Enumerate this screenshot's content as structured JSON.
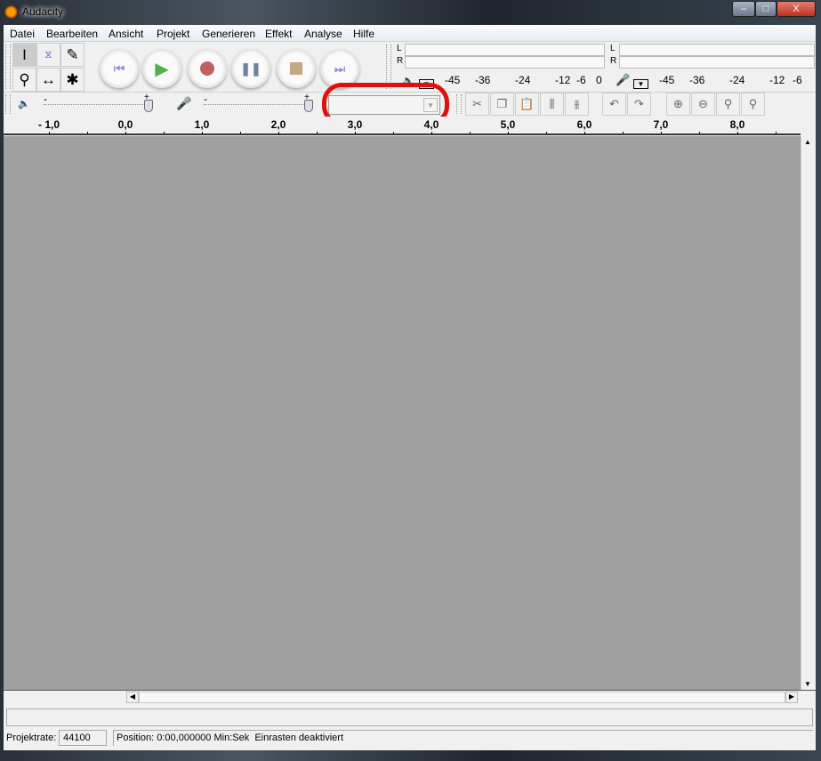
{
  "window": {
    "title": "Audacity",
    "minimize": "–",
    "maximize": "□",
    "close": "X"
  },
  "menu": [
    "Datei",
    "Bearbeiten",
    "Ansicht",
    "Projekt",
    "Generieren",
    "Effekt",
    "Analyse",
    "Hilfe"
  ],
  "tools": {
    "selection": "I",
    "envelope": "envelope",
    "draw": "✎",
    "zoom": "⚲",
    "timeshift": "↔",
    "multi": "✱"
  },
  "transport": [
    "skip-start",
    "play",
    "record",
    "pause",
    "stop",
    "skip-end"
  ],
  "transport_colors": {
    "skip": "#9a80d0",
    "play": "#50b050",
    "record": "#c06060",
    "pause": "#7080a0",
    "stop": "#c0a880"
  },
  "meters": {
    "channel_l": "L",
    "channel_r": "R",
    "output_scale": [
      "-45",
      "-36",
      "-24",
      "-12",
      "-6",
      "0"
    ],
    "input_scale": [
      "-45",
      "-36",
      "-24",
      "-12",
      "-6"
    ]
  },
  "mixer": {
    "minus": "-",
    "plus": "+"
  },
  "device_combo": {
    "value": ""
  },
  "annotation_color": "#e01010",
  "ruler": [
    "- 1,0",
    "0,0",
    "1,0",
    "2,0",
    "3,0",
    "4,0",
    "5,0",
    "6,0",
    "7,0",
    "8,0"
  ],
  "status": {
    "rate_label": "Projektrate:",
    "rate_value": "44100",
    "position": "Position: 0:00,000000 Min:Sek",
    "snap": "Einrasten deaktiviert"
  }
}
